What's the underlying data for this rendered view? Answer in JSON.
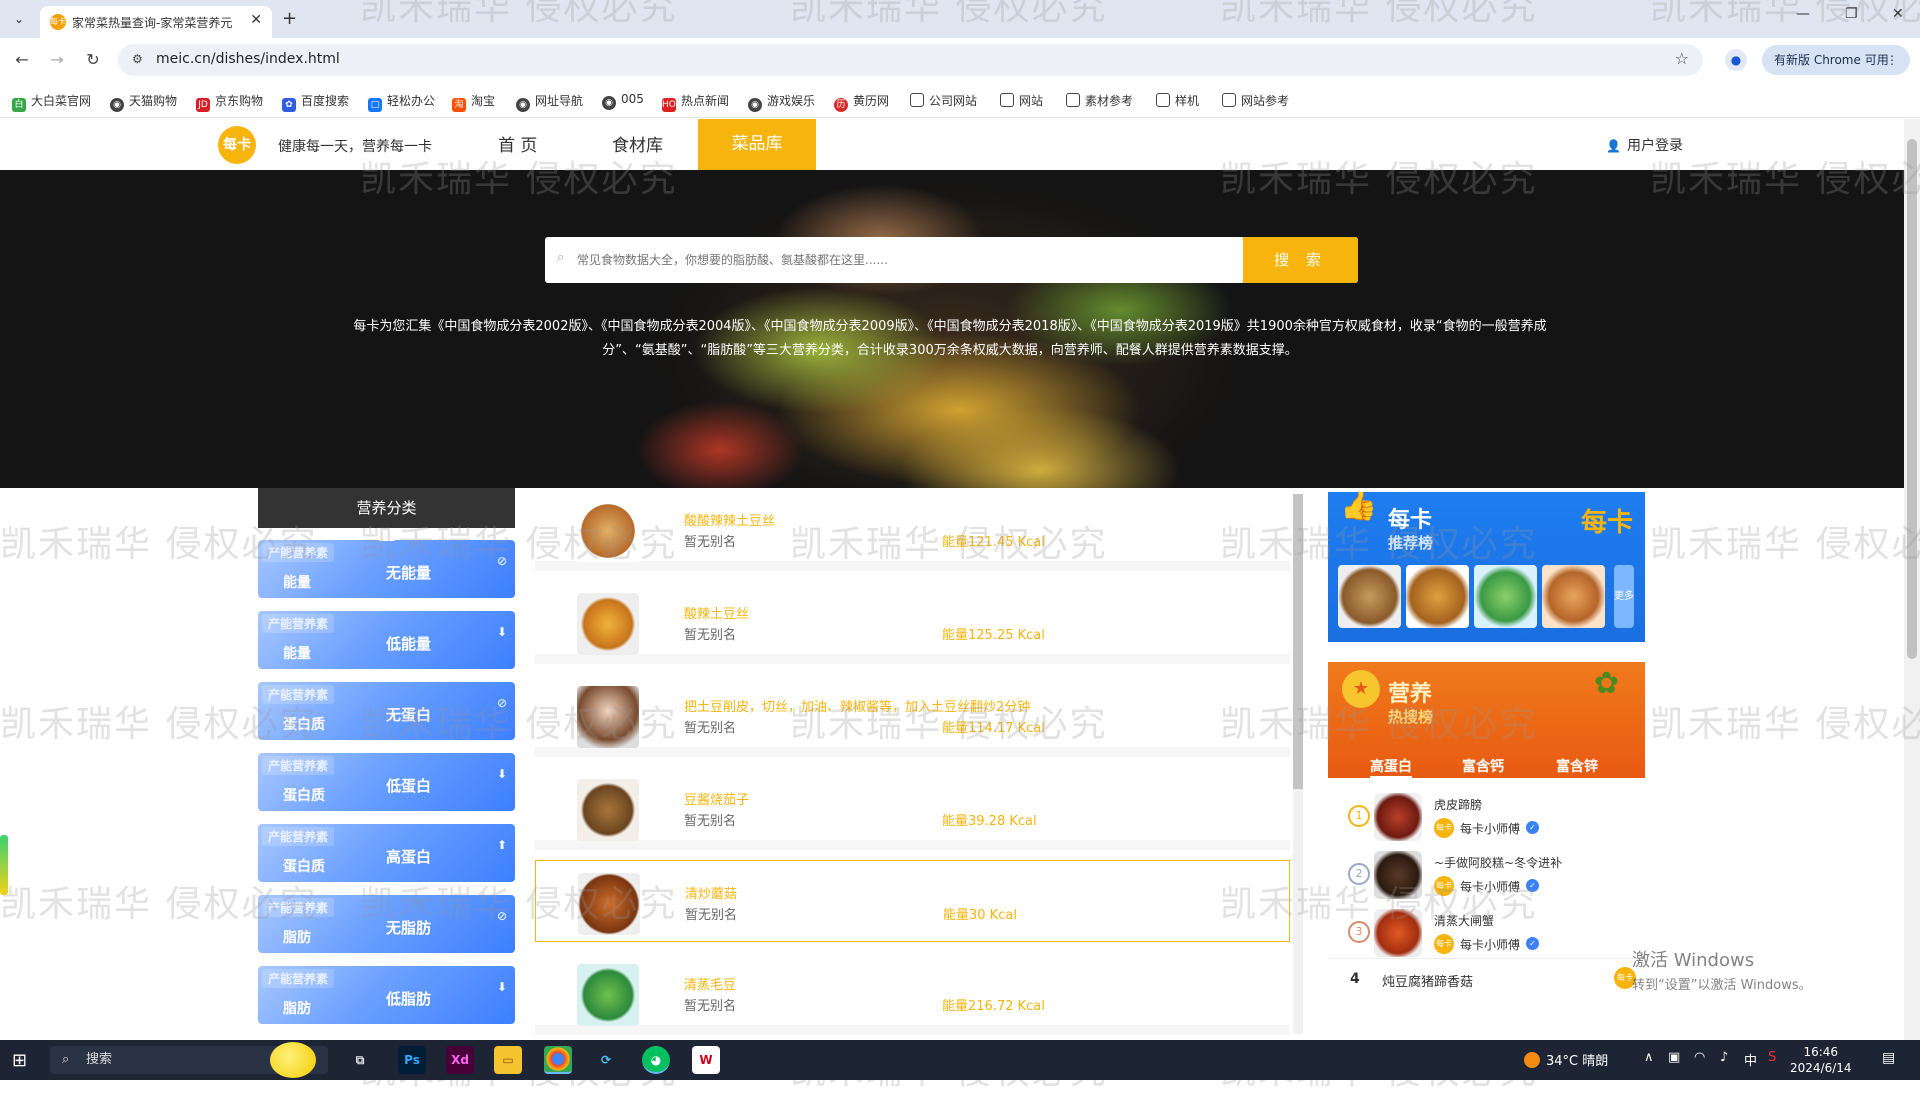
{
  "browser": {
    "tab_title": "家常菜热量查询-家常菜营养元",
    "url": "meic.cn/dishes/index.html",
    "update_label": "有新版 Chrome 可用",
    "bookmarks": [
      "大白菜官网",
      "天猫购物",
      "京东购物",
      "百度搜索",
      "轻松办公",
      "淘宝",
      "网址导航",
      "005",
      "热点新闻",
      "游戏娱乐",
      "黄历网",
      "公司网站",
      "网站",
      "素材参考",
      "样机",
      "网站参考"
    ]
  },
  "site": {
    "logo_text": "每卡",
    "slogan": "健康每一天，营养每一卡",
    "nav": [
      "首 页",
      "食材库",
      "菜品库"
    ],
    "login": "用户登录"
  },
  "hero": {
    "search_placeholder": "常见食物数据大全，你想要的脂肪酸、氨基酸都在这里......",
    "search_button": "搜 索",
    "intro": "每卡为您汇集《中国食物成分表2002版》、《中国食物成分表2004版》、《中国食物成分表2009版》、《中国食物成分表2018版》、《中国食物成分表2019版》共1900余种官方权威食材，收录“食物的一般营养成分”、“氨基酸”、“脂肪酸”等三大营养分类，合计收录300万余条权威大数据，向营养师、配餐人群提供营养素数据支撑。"
  },
  "categories": {
    "title": "营养分类",
    "items": [
      {
        "tag": "产能营养素",
        "kind": "能量",
        "level": "无能量",
        "mark": "⊘"
      },
      {
        "tag": "产能营养素",
        "kind": "能量",
        "level": "低能量",
        "mark": "⬇"
      },
      {
        "tag": "产能营养素",
        "kind": "蛋白质",
        "level": "无蛋白",
        "mark": "⊘"
      },
      {
        "tag": "产能营养素",
        "kind": "蛋白质",
        "level": "低蛋白",
        "mark": "⬇"
      },
      {
        "tag": "产能营养素",
        "kind": "蛋白质",
        "level": "高蛋白",
        "mark": "⬆"
      },
      {
        "tag": "产能营养素",
        "kind": "脂肪",
        "level": "无脂肪",
        "mark": "⊘"
      },
      {
        "tag": "产能营养素",
        "kind": "脂肪",
        "level": "低脂肪",
        "mark": "⬇"
      }
    ]
  },
  "foods": [
    {
      "name": "酸酸辣辣土豆丝",
      "alias": "暂无别名",
      "energy": "能量121.45 Kcal"
    },
    {
      "name": "酸辣土豆丝",
      "alias": "暂无别名",
      "energy": "能量125.25 Kcal"
    },
    {
      "name": "把土豆削皮，切丝，加油、辣椒酱等，加入土豆丝翻炒2分钟",
      "alias": "暂无别名",
      "energy": "能量114.17 Kcal"
    },
    {
      "name": "豆酱烧茄子",
      "alias": "暂无别名",
      "energy": "能量39.28 Kcal"
    },
    {
      "name": "清炒蘑菇",
      "alias": "暂无别名",
      "energy": "能量30 Kcal"
    },
    {
      "name": "清蒸毛豆",
      "alias": "暂无别名",
      "energy": "能量216.72 Kcal"
    }
  ],
  "recommend": {
    "title": "每卡",
    "subtitle": "推荐榜",
    "brand": "每卡",
    "more": "更多"
  },
  "hot": {
    "title": "营养",
    "subtitle": "热搜榜",
    "tabs": [
      "高蛋白",
      "富含钙",
      "富含锌"
    ],
    "ranks": [
      {
        "num": "1",
        "title": "虎皮蹄膀",
        "author": "每卡小师傅"
      },
      {
        "num": "2",
        "title": "~手做阿胶糕~冬令进补",
        "author": "每卡小师傅"
      },
      {
        "num": "3",
        "title": "清蒸大闸蟹",
        "author": "每卡小师傅"
      }
    ],
    "rank4": {
      "num": "4",
      "title": "炖豆腐猪蹄香菇"
    }
  },
  "watermark": "凯禾瑞华 侵权必究",
  "activate": {
    "line1": "激活 Windows",
    "line2": "转到“设置”以激活 Windows。"
  },
  "taskbar": {
    "search": "搜索",
    "weather": "34°C 晴朗",
    "ime": "中",
    "time": "16:46",
    "date": "2024/6/14"
  }
}
